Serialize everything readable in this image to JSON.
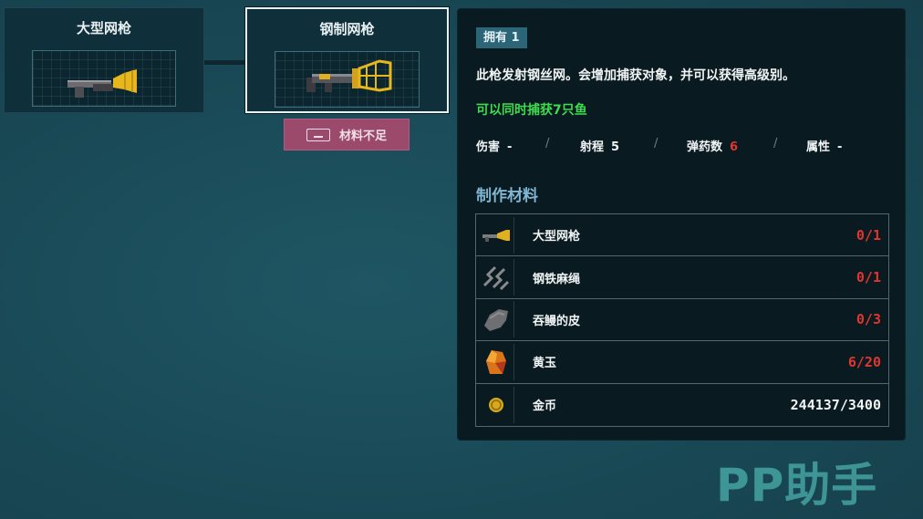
{
  "tree": {
    "cards": [
      {
        "name": "大型网枪",
        "selected": false
      },
      {
        "name": "钢制网枪",
        "selected": true
      }
    ],
    "insufficient_label": "材料不足"
  },
  "detail": {
    "own_badge": "拥有 1",
    "description": "此枪发射钢丝网。会增加捕获对象，并可以获得高级别。",
    "highlight": "可以同时捕获7只鱼",
    "stats": [
      {
        "label": "伤害",
        "value": "-"
      },
      {
        "label": "射程",
        "value": "5"
      },
      {
        "label": "弹药数",
        "value": "6",
        "color": "#e0362f"
      },
      {
        "label": "属性",
        "value": "-"
      }
    ],
    "materials_title": "制作材料",
    "materials": [
      {
        "icon": "net-gun-icon",
        "name": "大型网枪",
        "count": "0/1",
        "color": "#e0362f"
      },
      {
        "icon": "rope-icon",
        "name": "钢铁麻绳",
        "count": "0/1",
        "color": "#e0362f"
      },
      {
        "icon": "skin-icon",
        "name": "吞鳗的皮",
        "count": "0/3",
        "color": "#e0362f"
      },
      {
        "icon": "topaz-icon",
        "name": "黄玉",
        "count": "6/20",
        "color": "#e0362f"
      },
      {
        "icon": "coin-icon",
        "name": "金币",
        "count": "244137/3400",
        "color": "#f0f4f5"
      }
    ]
  },
  "watermark": "PP助手"
}
